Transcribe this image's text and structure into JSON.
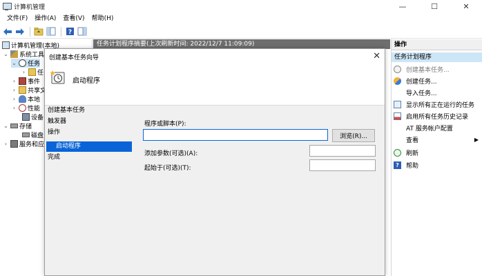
{
  "window": {
    "title": "计算机管理",
    "minimize": "—",
    "maximize": "☐",
    "close": "✕"
  },
  "menu": [
    {
      "label": "文件(F)"
    },
    {
      "label": "操作(A)"
    },
    {
      "label": "查看(V)"
    },
    {
      "label": "帮助(H)"
    }
  ],
  "tree": {
    "items": [
      {
        "label": "计算机管理(本地)"
      },
      {
        "label": "系统工具"
      },
      {
        "label": "任务"
      },
      {
        "label": "任"
      },
      {
        "label": "事件"
      },
      {
        "label": "共享文"
      },
      {
        "label": "本地"
      },
      {
        "label": "性能"
      },
      {
        "label": "设备"
      },
      {
        "label": "存储"
      },
      {
        "label": "磁盘"
      },
      {
        "label": "服务和应"
      }
    ]
  },
  "center": {
    "header": "任务计划程序摘要(上次刷新时间: 2022/12/7 11:09:09)"
  },
  "wizard": {
    "title": "创建基本任务向导",
    "close": "✕",
    "header_title": "启动程序",
    "steps": [
      {
        "label": "创建基本任务"
      },
      {
        "label": "触发器"
      },
      {
        "label": "操作"
      },
      {
        "label": "启动程序"
      },
      {
        "label": "完成"
      }
    ],
    "program_label": "程序或脚本(P):",
    "program_value": "",
    "browse_button": "浏览(R)...",
    "args_label": "添加参数(可选)(A):",
    "args_value": "",
    "start_in_label": "起始于(可选)(T):",
    "start_in_value": ""
  },
  "actions": {
    "header": "操作",
    "section": "任务计划程序",
    "items": [
      {
        "label": "创建基本任务..."
      },
      {
        "label": "创建任务..."
      },
      {
        "label": "导入任务..."
      },
      {
        "label": "显示所有正在运行的任务"
      },
      {
        "label": "启用所有任务历史记录"
      },
      {
        "label": "AT 服务帐户配置"
      },
      {
        "label": "查看"
      },
      {
        "label": "刷新"
      },
      {
        "label": "帮助"
      }
    ]
  }
}
